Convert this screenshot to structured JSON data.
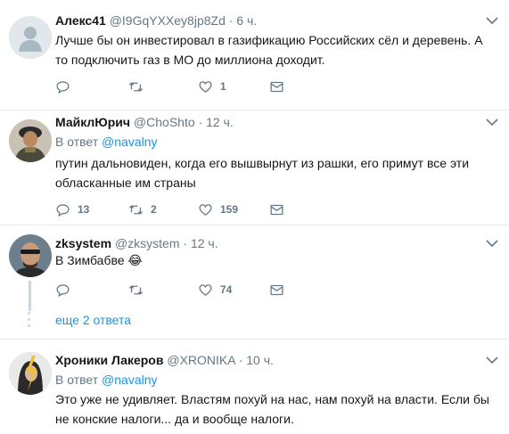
{
  "tweets": [
    {
      "name": "Алекс41",
      "handle": "@I9GqYXXey8jp8Zd",
      "time": "6 ч.",
      "text": "Лучше бы он инвестировал в газификацию Российских сёл и деревень. А то подключить газ в МО до миллиона доходит.",
      "replies": "",
      "retweets": "",
      "likes": "1"
    },
    {
      "name": "МайклЮрич",
      "handle": "@ChoShto",
      "time": "12 ч.",
      "reply_prefix": "В ответ",
      "reply_mention": "@navalny",
      "text": "путин дальновиден, когда его вышвырнут из рашки, его примут все эти обласканные им страны",
      "replies": "13",
      "retweets": "2",
      "likes": "159"
    },
    {
      "name": "zksystem",
      "handle": "@zksystem",
      "time": "12 ч.",
      "text": "В Зимбабве 😂",
      "replies": "",
      "retweets": "",
      "likes": "74"
    },
    {
      "name": "Хроники Лакеров",
      "handle": "@XRONIKA",
      "time": "10 ч.",
      "reply_prefix": "В ответ",
      "reply_mention": "@navalny",
      "text": "Это уже не удивляет. Властям похуй на нас, нам похуй на власти. Если бы не конские налоги... да и вообще налоги."
    }
  ],
  "more_replies": "еще 2 ответа",
  "separator": "·",
  "icons": {
    "reply": "reply-icon",
    "retweet": "retweet-icon",
    "like": "heart-icon",
    "dm": "envelope-icon",
    "caret": "chevron-down-icon"
  },
  "colors": {
    "link": "#1b95e0",
    "secondary": "#657786",
    "divider": "#e6ecf0"
  }
}
